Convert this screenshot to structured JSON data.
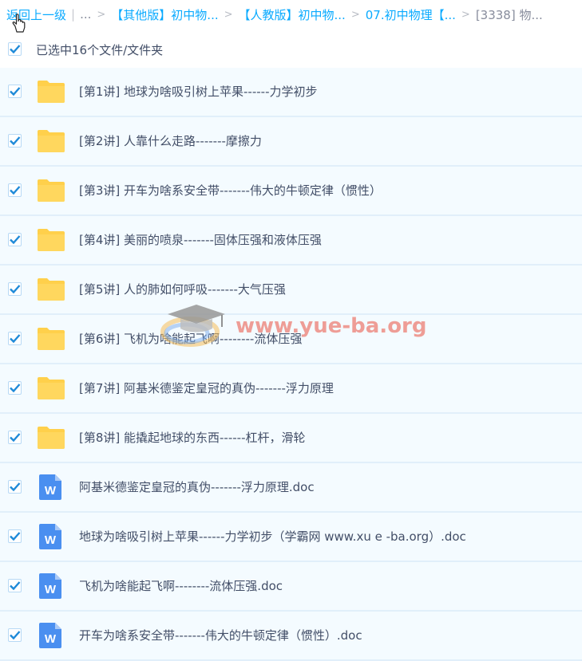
{
  "breadcrumb": {
    "back": "返回上一级",
    "ellipsis": "...",
    "items": [
      "【其他版】初中物...",
      "【人教版】初中物...",
      "07.初中物理【...",
      "[3338] 物..."
    ]
  },
  "selection": {
    "label": "已选中16个文件/文件夹",
    "checked": true
  },
  "files": [
    {
      "type": "folder",
      "name": "[第1讲] 地球为啥吸引树上苹果------力学初步"
    },
    {
      "type": "folder",
      "name": "[第2讲] 人靠什么走路-------摩擦力"
    },
    {
      "type": "folder",
      "name": "[第3讲] 开车为啥系安全带-------伟大的牛顿定律（惯性）"
    },
    {
      "type": "folder",
      "name": "[第4讲] 美丽的喷泉-------固体压强和液体压强"
    },
    {
      "type": "folder",
      "name": "[第5讲] 人的肺如何呼吸-------大气压强"
    },
    {
      "type": "folder",
      "name": "[第6讲] 飞机为啥能起飞啊--------流体压强"
    },
    {
      "type": "folder",
      "name": "[第7讲] 阿基米德鉴定皇冠的真伪-------浮力原理"
    },
    {
      "type": "folder",
      "name": "[第8讲] 能撬起地球的东西------杠杆，滑轮"
    },
    {
      "type": "doc",
      "name": "阿基米德鉴定皇冠的真伪-------浮力原理.doc"
    },
    {
      "type": "doc",
      "name": "地球为啥吸引树上苹果------力学初步（学霸网 www.xu e -ba.org）.doc"
    },
    {
      "type": "doc",
      "name": "飞机为啥能起飞啊--------流体压强.doc"
    },
    {
      "type": "doc",
      "name": "开车为啥系安全带-------伟大的牛顿定律（惯性）.doc"
    }
  ],
  "doc_icon_letter": "W",
  "watermark": {
    "text": "www.yue-ba.org"
  },
  "colors": {
    "link": "#09aaff",
    "folder": "#ffd04b",
    "doc": "#4a8ff0",
    "check": "#1f8ad8",
    "row_bg": "#f4fbff"
  }
}
